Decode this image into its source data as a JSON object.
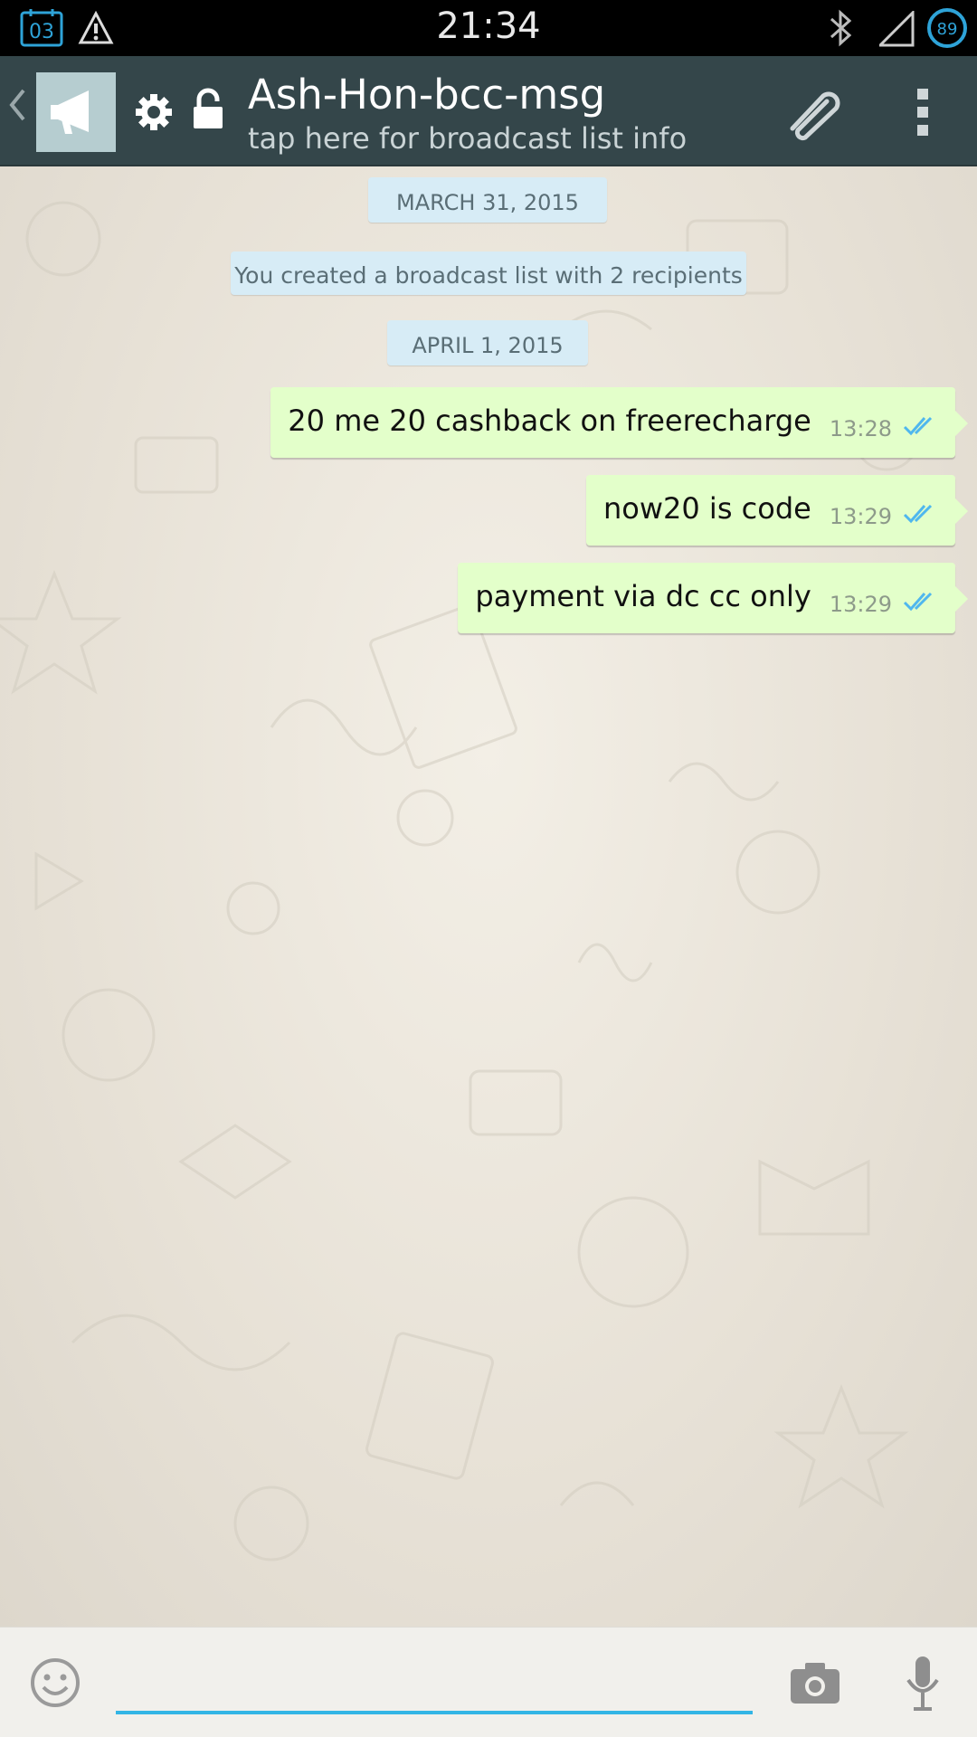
{
  "status_bar": {
    "calendar_day": "03",
    "time": "21:34",
    "battery_level": "89",
    "icons": [
      "calendar-icon",
      "warning-icon",
      "bluetooth-icon",
      "signal-icon",
      "battery-icon"
    ]
  },
  "header": {
    "title": "Ash-Hon-bcc-msg",
    "subtitle": "tap here for broadcast list info",
    "icons": [
      "back-chevron-icon",
      "broadcast-megaphone-icon",
      "gear-icon",
      "lock-icon",
      "paperclip-icon",
      "overflow-menu-icon"
    ],
    "bar_color": "#34464a"
  },
  "chat": {
    "date_1": "MARCH 31, 2015",
    "system_message": "You created a broadcast list with 2 recipients",
    "date_2": "APRIL 1, 2015",
    "messages": [
      {
        "text": "20 me 20 cashback on freerecharge",
        "time": "13:28",
        "status": "read"
      },
      {
        "text": "now20 is code",
        "time": "13:29",
        "status": "read"
      },
      {
        "text": "payment via dc cc only",
        "time": "13:29",
        "status": "read"
      }
    ],
    "bubble_color": "#e3ffca",
    "tick_color": "#4fb7ee"
  },
  "input_bar": {
    "value": "",
    "placeholder": "",
    "icons": [
      "emoji-icon",
      "camera-icon",
      "microphone-icon"
    ],
    "accent": "#33b5e5"
  }
}
